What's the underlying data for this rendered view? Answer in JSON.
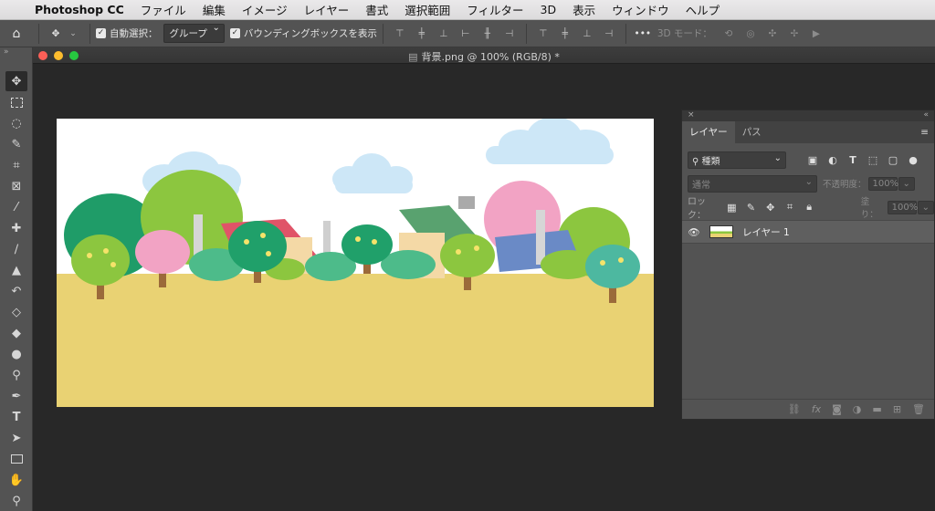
{
  "menubar": {
    "app_name": "Photoshop CC",
    "items": [
      "ファイル",
      "編集",
      "イメージ",
      "レイヤー",
      "書式",
      "選択範囲",
      "フィルター",
      "3D",
      "表示",
      "ウィンドウ",
      "ヘルプ"
    ]
  },
  "options_bar": {
    "auto_select_label": "自動選択：",
    "auto_select_value": "グループ",
    "bounding_box_label": "バウンディングボックスを表示",
    "three_d_mode_label": "3D モード："
  },
  "document": {
    "title": "背景.png @ 100% (RGB/8) *"
  },
  "layers_panel": {
    "tabs": [
      "レイヤー",
      "パス"
    ],
    "filter_label": "種類",
    "blend_mode": "通常",
    "opacity_label": "不透明度：",
    "opacity_value": "100%",
    "lock_label": "ロック：",
    "fill_label": "塗り：",
    "fill_value": "100%",
    "layer_name": "レイヤー 1"
  },
  "colors": {
    "sky": "#ffffff",
    "ground": "#e9d273",
    "cloud": "#cde7f7",
    "tree_green": "#8cc63f",
    "tree_dark": "#20a06a",
    "tree_pink": "#f2a3c4",
    "trunk": "#9b6a3a"
  }
}
